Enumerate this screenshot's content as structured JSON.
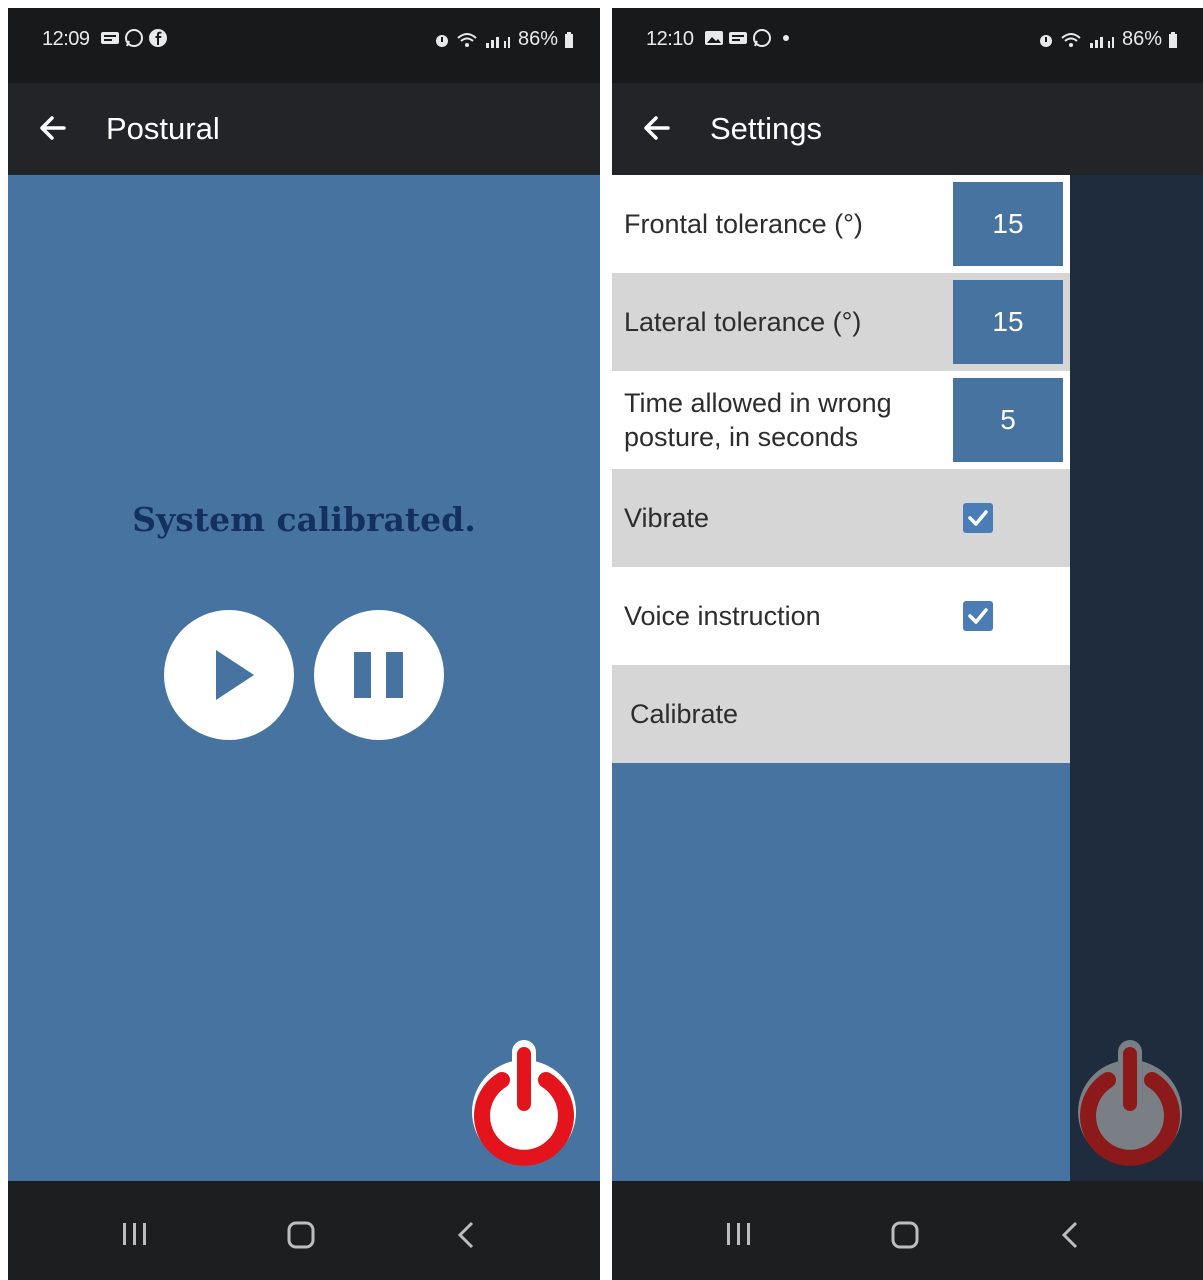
{
  "left_screen": {
    "status": {
      "time": "12:09",
      "battery": "86%"
    },
    "appbar": {
      "title": "Postural"
    },
    "main": {
      "status_message": "System calibrated."
    }
  },
  "right_screen": {
    "status": {
      "time": "12:10",
      "battery": "86%"
    },
    "appbar": {
      "title": "Settings"
    },
    "settings": {
      "frontal_tolerance_label": "Frontal tolerance (°)",
      "frontal_tolerance_value": "15",
      "lateral_tolerance_label": "Lateral tolerance (°)",
      "lateral_tolerance_value": "15",
      "time_allowed_label": "Time allowed in wrong posture, in seconds",
      "time_allowed_value": "5",
      "vibrate_label": "Vibrate",
      "vibrate_checked": true,
      "voice_instruction_label": "Voice instruction",
      "voice_instruction_checked": true,
      "calibrate_label": "Calibrate"
    }
  },
  "colors": {
    "content_blue": "#4673a0",
    "appbar": "#232427",
    "power_red": "#e3141b",
    "power_dim_red": "#8c1a1a",
    "title_navy": "#13305e"
  },
  "icons": [
    "back-arrow-icon",
    "play-icon",
    "pause-icon",
    "power-icon",
    "checkbox-checked-icon",
    "recent-apps-icon",
    "home-icon",
    "nav-back-icon"
  ]
}
